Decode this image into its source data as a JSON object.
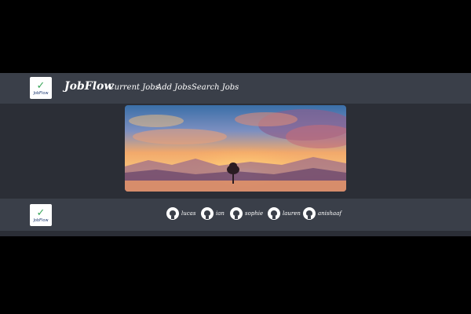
{
  "navbar": {
    "logo_text": "JobFlow",
    "brand": "JobFlow",
    "links": [
      {
        "label": "Current Jobs"
      },
      {
        "label": "Add Jobs"
      },
      {
        "label": "Search Jobs"
      }
    ]
  },
  "hero": {
    "icon": "sunset-landscape-image"
  },
  "footer": {
    "logo_text": "JobFlow",
    "contributors": [
      {
        "name": "lucas",
        "icon": "github-icon"
      },
      {
        "name": "ian",
        "icon": "github-icon"
      },
      {
        "name": "sophie",
        "icon": "github-icon"
      },
      {
        "name": "lauren",
        "icon": "github-icon"
      },
      {
        "name": "anishaaf",
        "icon": "github-icon"
      }
    ]
  },
  "colors": {
    "navbar_bg": "#3a3f49",
    "page_bg": "#2b2e36",
    "outer_bg": "#000000"
  }
}
